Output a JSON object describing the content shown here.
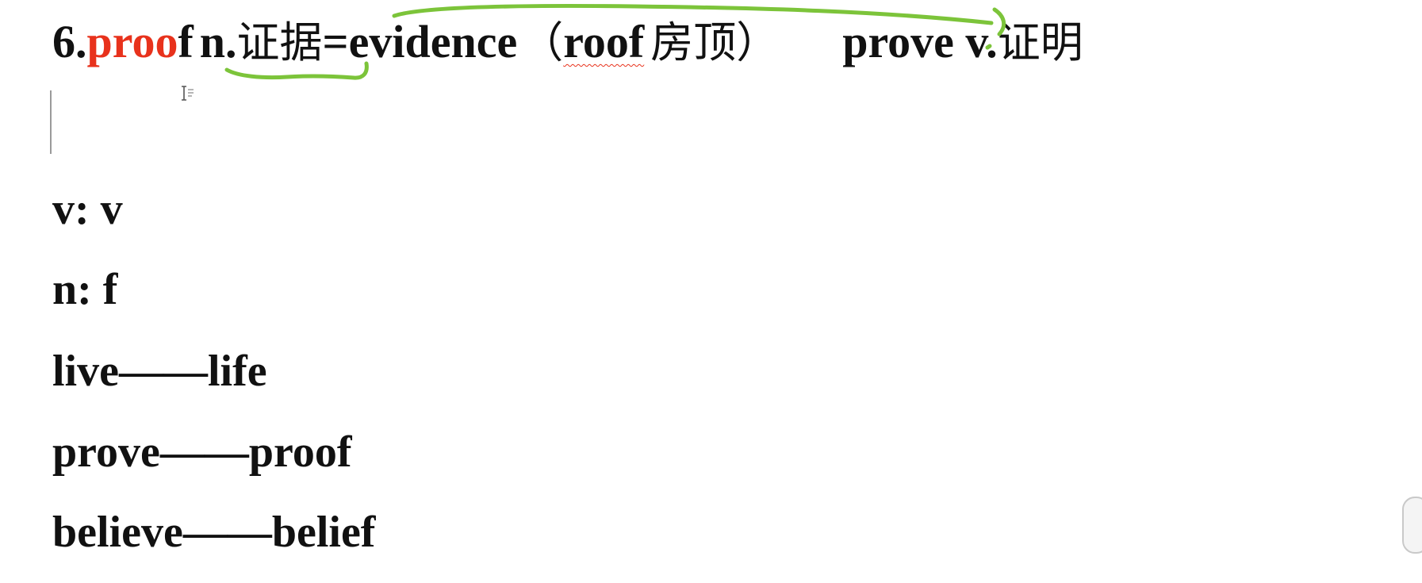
{
  "heading": {
    "number": "6.",
    "word_red": "proo",
    "word_rest": "f",
    "pos": "n.",
    "meaning": "证据",
    "equals": "=evidence",
    "paren_open": "（",
    "roof": "roof",
    "roof_meaning": "房顶",
    "paren_close": "）",
    "verb": "prove v.",
    "verb_meaning": "证明"
  },
  "rules": [
    {
      "text": "v: v"
    },
    {
      "text": "n: f"
    }
  ],
  "pairs": [
    {
      "verb": "live",
      "dash": "——",
      "noun": "life"
    },
    {
      "verb": "prove",
      "dash": "——",
      "noun": "proof"
    },
    {
      "verb": "believe",
      "dash": "——",
      "noun": "belief"
    }
  ],
  "colors": {
    "accent_red": "#e8321c",
    "annotation_green": "#7cc43a"
  },
  "icons": [
    "text-cursor-icon",
    "edge-handle-icon"
  ]
}
